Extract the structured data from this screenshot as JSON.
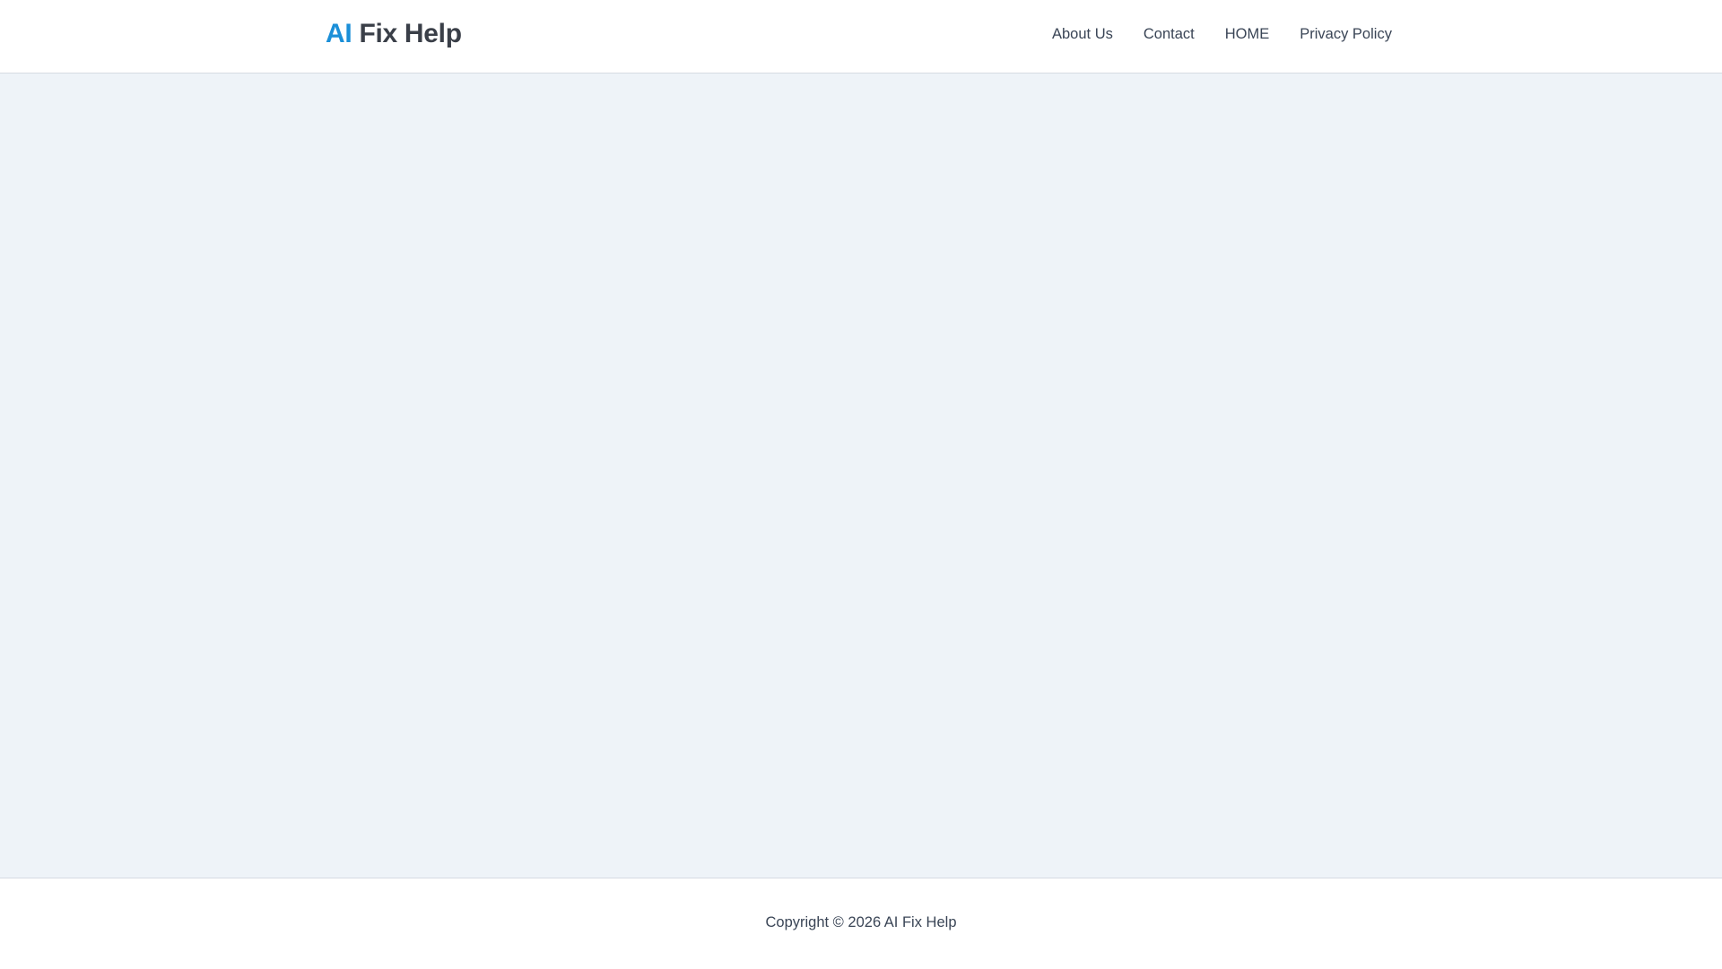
{
  "header": {
    "logo": {
      "part1": "AI",
      "part2": "Fix Help",
      "accent_color": "#1b8fd8"
    },
    "nav": [
      {
        "label": "About Us"
      },
      {
        "label": "Contact"
      },
      {
        "label": "HOME"
      },
      {
        "label": "Privacy Policy"
      }
    ]
  },
  "footer": {
    "copyright": "Copyright © 2026 AI Fix Help"
  }
}
